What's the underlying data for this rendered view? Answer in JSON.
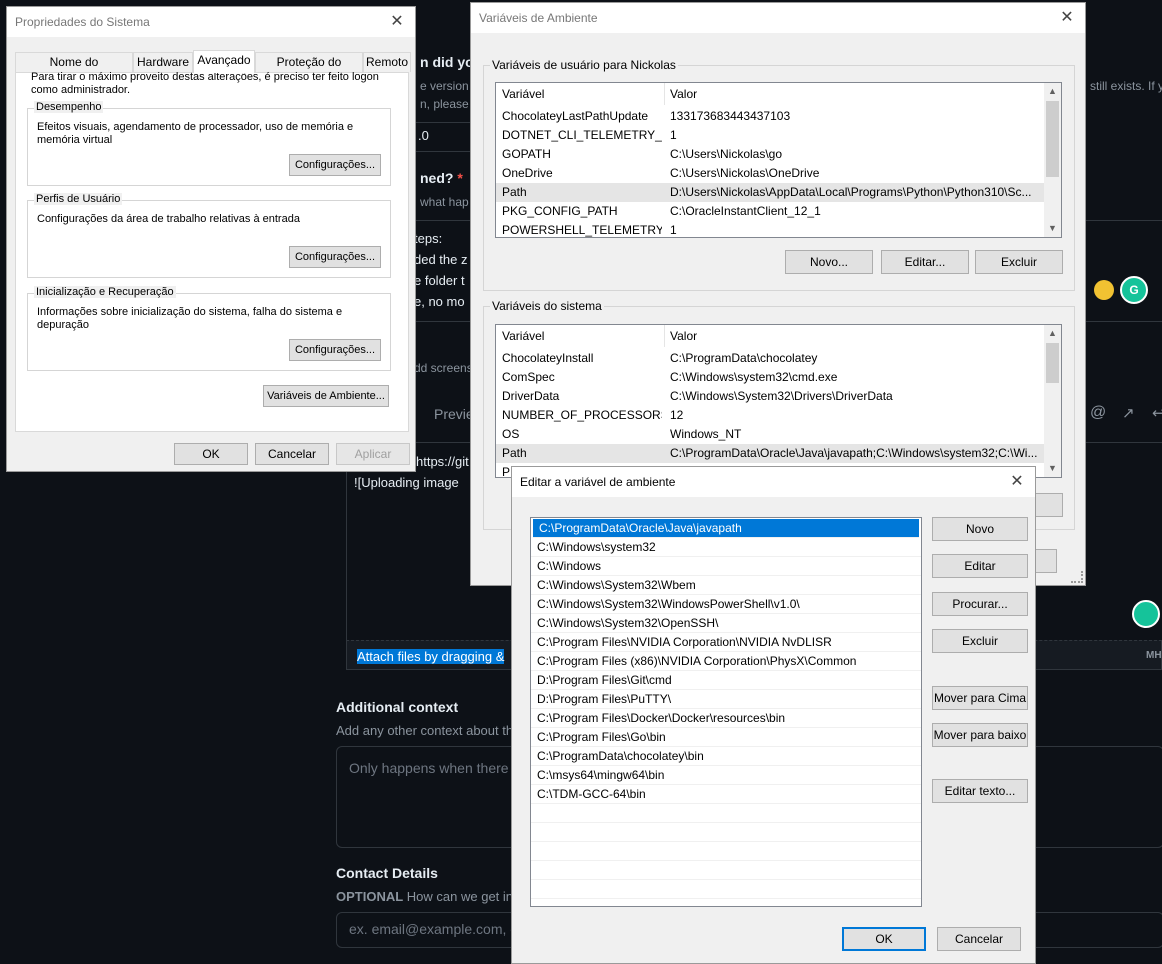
{
  "background": {
    "frag_did_you": "n did you",
    "frag_version": "e version c",
    "frag_please": "n, please i",
    "frag_still_exists": "still exists. If yo",
    "frag_0": ".0",
    "frag_ned": "ned?",
    "frag_required": "*",
    "frag_what_hap": "what hap",
    "frag_steps": "teps:",
    "frag_ded_the": "ded the z",
    "frag_e_folder": "e folder t",
    "frag_e_no_mo": "e, no mo",
    "frag_add_screens": "dd screens",
    "frag_preview": "Previe",
    "frag_https": "https://git",
    "frag_uploading": "![Uploading image",
    "attach_text": "Attach files by dragging &",
    "md_badge": "MH",
    "additional_context_title": "Additional context",
    "additional_context_desc": "Add any other context about the",
    "additional_context_placeholder": "Only happens when there",
    "contact_title": "Contact Details",
    "contact_optional": "OPTIONAL",
    "contact_desc": "How can we get in to",
    "email_placeholder": "ex. email@example.com, c"
  },
  "system_properties": {
    "title": "Propriedades do Sistema",
    "tabs": [
      "Nome do Computador",
      "Hardware",
      "Avançado",
      "Proteção do Sistema",
      "Remoto"
    ],
    "active_tab": "Avançado",
    "intro": "Para tirar o máximo proveito destas alterações, é preciso ter feito logon como administrador.",
    "performance": {
      "label": "Desempenho",
      "desc": "Efeitos visuais, agendamento de processador, uso de memória e memória virtual",
      "button": "Configurações..."
    },
    "profiles": {
      "label": "Perfis de Usuário",
      "desc": "Configurações da área de trabalho relativas à entrada",
      "button": "Configurações..."
    },
    "startup": {
      "label": "Inicialização e Recuperação",
      "desc": "Informações sobre inicialização do sistema, falha do sistema e depuração",
      "button": "Configurações..."
    },
    "env_button": "Variáveis de Ambiente...",
    "ok": "OK",
    "cancel": "Cancelar",
    "apply": "Aplicar"
  },
  "env_vars": {
    "title": "Variáveis de Ambiente",
    "user_group": "Variáveis de usuário para Nickolas",
    "col_var": "Variável",
    "col_val": "Valor",
    "user_rows": [
      {
        "name": "ChocolateyLastPathUpdate",
        "value": "133173683443437103"
      },
      {
        "name": "DOTNET_CLI_TELEMETRY_O...",
        "value": "1"
      },
      {
        "name": "GOPATH",
        "value": "C:\\Users\\Nickolas\\go"
      },
      {
        "name": "OneDrive",
        "value": "C:\\Users\\Nickolas\\OneDrive"
      },
      {
        "name": "Path",
        "value": "D:\\Users\\Nickolas\\AppData\\Local\\Programs\\Python\\Python310\\Sc..."
      },
      {
        "name": "PKG_CONFIG_PATH",
        "value": "C:\\OracleInstantClient_12_1"
      },
      {
        "name": "POWERSHELL_TELEMETRY_...",
        "value": "1"
      }
    ],
    "user_new": "Novo...",
    "user_edit": "Editar...",
    "user_delete": "Excluir",
    "system_group": "Variáveis do sistema",
    "system_rows": [
      {
        "name": "ChocolateyInstall",
        "value": "C:\\ProgramData\\chocolatey"
      },
      {
        "name": "ComSpec",
        "value": "C:\\Windows\\system32\\cmd.exe"
      },
      {
        "name": "DriverData",
        "value": "C:\\Windows\\System32\\Drivers\\DriverData"
      },
      {
        "name": "NUMBER_OF_PROCESSORS",
        "value": "12"
      },
      {
        "name": "OS",
        "value": "Windows_NT"
      },
      {
        "name": "Path",
        "value": "C:\\ProgramData\\Oracle\\Java\\javapath;C:\\Windows\\system32;C:\\Wi..."
      },
      {
        "name": "P",
        "value": ""
      }
    ]
  },
  "edit_env": {
    "title": "Editar a variável de ambiente",
    "paths": [
      "C:\\ProgramData\\Oracle\\Java\\javapath",
      "C:\\Windows\\system32",
      "C:\\Windows",
      "C:\\Windows\\System32\\Wbem",
      "C:\\Windows\\System32\\WindowsPowerShell\\v1.0\\",
      "C:\\Windows\\System32\\OpenSSH\\",
      "C:\\Program Files\\NVIDIA Corporation\\NVIDIA NvDLISR",
      "C:\\Program Files (x86)\\NVIDIA Corporation\\PhysX\\Common",
      "D:\\Program Files\\Git\\cmd",
      "D:\\Program Files\\PuTTY\\",
      "C:\\Program Files\\Docker\\Docker\\resources\\bin",
      "C:\\Program Files\\Go\\bin",
      "C:\\ProgramData\\chocolatey\\bin",
      "C:\\msys64\\mingw64\\bin",
      "C:\\TDM-GCC-64\\bin"
    ],
    "new": "Novo",
    "edit": "Editar",
    "browse": "Procurar...",
    "delete": "Excluir",
    "move_up": "Mover para Cima",
    "move_down": "Mover para baixo",
    "edit_text": "Editar texto...",
    "ok": "OK",
    "cancel": "Cancelar"
  }
}
